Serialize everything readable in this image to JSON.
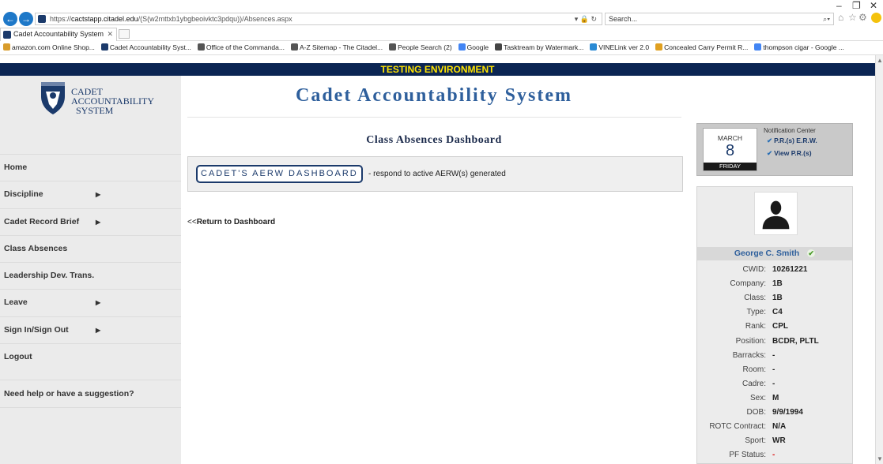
{
  "browser": {
    "url_scheme": "https://",
    "url_host": "cactstapp.citadel.edu",
    "url_path": "/(S(w2mttxb1ybgbeoivktc3pdqu))/Absences.aspx",
    "search_placeholder": "Search...",
    "tab_title": "Cadet Accountability System",
    "favorites": [
      "amazon.com Online Shop...",
      "Cadet Accountability Syst...",
      "Office of the Commanda...",
      "A-Z Sitemap - The Citadel...",
      "People Search (2)",
      "Google",
      "Tasktream by Watermark...",
      "VINELink ver 2.0",
      "Concealed Carry Permit R...",
      "thompson cigar - Google ..."
    ]
  },
  "banner": {
    "text": "TESTING ENVIRONMENT"
  },
  "logo": {
    "line1": "CADET",
    "line2": "ACCOUNTABILITY",
    "line3": "SYSTEM"
  },
  "sidebar": {
    "items": [
      {
        "label": "Home",
        "submenu": false
      },
      {
        "label": "Discipline",
        "submenu": true
      },
      {
        "label": "Cadet Record Brief",
        "submenu": true
      },
      {
        "label": "Class Absences",
        "submenu": false
      },
      {
        "label": "Leadership Dev. Trans.",
        "submenu": false
      },
      {
        "label": "Leave",
        "submenu": true
      },
      {
        "label": "Sign In/Sign Out",
        "submenu": true
      },
      {
        "label": "Logout",
        "submenu": false
      }
    ],
    "help": "Need help or have a suggestion?"
  },
  "main": {
    "app_title": "Cadet Accountability System",
    "dashboard_title": "Class Absences Dashboard",
    "aerw_button": "CADET'S AERW DASHBOARD",
    "aerw_text": "- respond to active AERW(s) generated",
    "return_prefix": "<<",
    "return_link": "Return to Dashboard"
  },
  "notifications": {
    "month": "MARCH",
    "day": "8",
    "weekday": "FRIDAY",
    "title": "Notification Center",
    "links": [
      "P.R.(s) E.R.W.",
      "View P.R.(s)"
    ]
  },
  "profile": {
    "name": "George C. Smith",
    "fields": [
      {
        "label": "CWID:",
        "value": "10261221"
      },
      {
        "label": "Company:",
        "value": "1B"
      },
      {
        "label": "Class:",
        "value": "1B"
      },
      {
        "label": "Type:",
        "value": "C4"
      },
      {
        "label": "Rank:",
        "value": "CPL"
      },
      {
        "label": "Position:",
        "value": "BCDR, PLTL"
      },
      {
        "label": "Barracks:",
        "value": "-"
      },
      {
        "label": "Room:",
        "value": "-"
      },
      {
        "label": "Cadre:",
        "value": "-"
      },
      {
        "label": "Sex:",
        "value": "M"
      },
      {
        "label": "DOB:",
        "value": "9/9/1994"
      },
      {
        "label": "ROTC Contract:",
        "value": "N/A"
      },
      {
        "label": "Sport:",
        "value": "WR"
      },
      {
        "label": "PF Status:",
        "value": "-"
      }
    ]
  },
  "colors": {
    "navy": "#0b2553",
    "banner_text": "#ffe400",
    "title_blue": "#2e5f9c",
    "status_red": "#d11111"
  }
}
